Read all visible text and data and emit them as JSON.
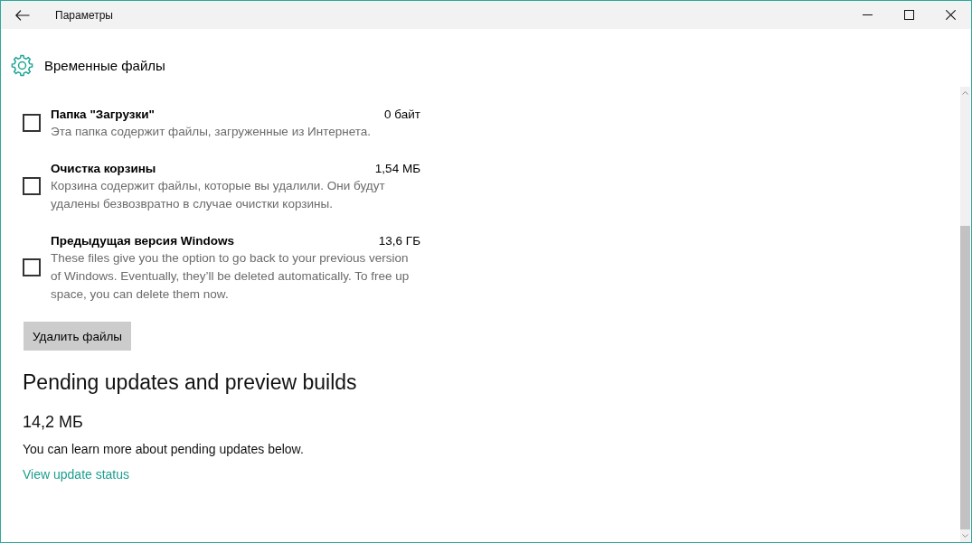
{
  "window": {
    "title": "Параметры"
  },
  "page": {
    "title": "Временные файлы"
  },
  "items": [
    {
      "label": "Папка \"Загрузки\"",
      "size": "0 байт",
      "description": "Эта папка содержит файлы, загруженные из Интернета.",
      "checked": false
    },
    {
      "label": "Очистка корзины",
      "size": "1,54 МБ",
      "description": "Корзина содержит файлы, которые вы удалили. Они будут удалены безвозвратно в случае очистки корзины.",
      "checked": false
    },
    {
      "label": "Предыдущая версия Windows",
      "size": "13,6 ГБ",
      "description": "These files give you the option to go back to your previous version of Windows. Eventually, they’ll be deleted automatically. To free up space, you can delete them now.",
      "checked": false
    }
  ],
  "delete_button": {
    "label": "Удалить файлы"
  },
  "pending": {
    "heading": "Pending updates and preview builds",
    "size": "14,2 МБ",
    "description": "You can learn more about pending updates below.",
    "link": "View update status"
  }
}
